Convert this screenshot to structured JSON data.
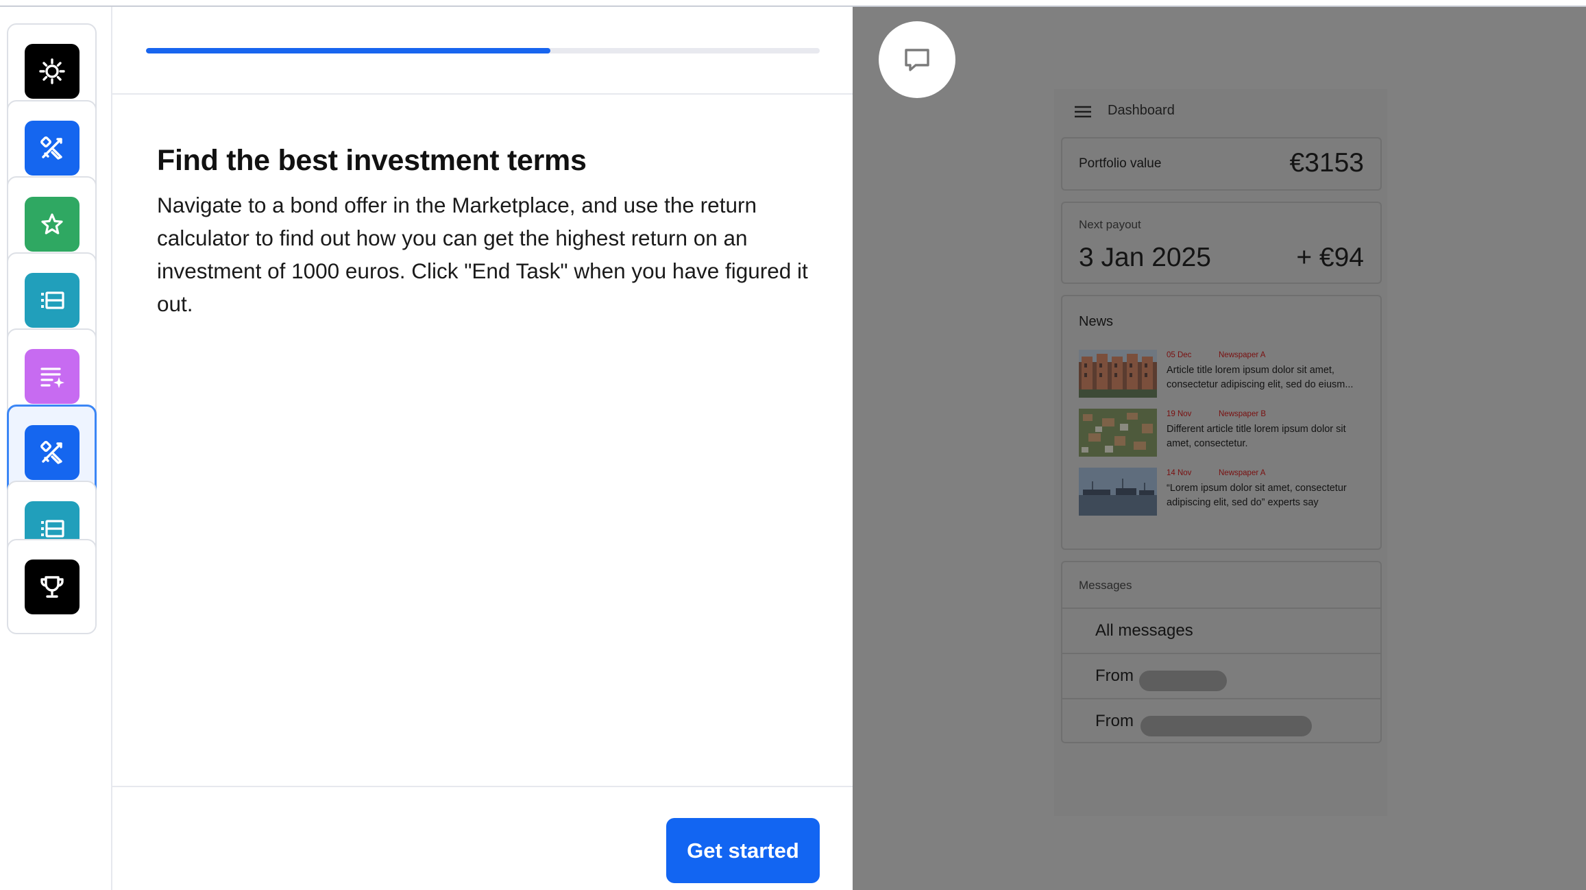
{
  "sidebar": {
    "items": [
      {
        "icon": "gear-icon",
        "tile_color": "#000000"
      },
      {
        "icon": "tools-icon",
        "tile_color": "#1566ef"
      },
      {
        "icon": "star-icon",
        "tile_color": "#2fa862"
      },
      {
        "icon": "list-icon",
        "tile_color": "#219fbb"
      },
      {
        "icon": "sparkle-list-icon",
        "tile_color": "#c76bf1"
      },
      {
        "icon": "tools-icon",
        "tile_color": "#1566ef",
        "active": true
      },
      {
        "icon": "list-icon",
        "tile_color": "#219fbb"
      },
      {
        "icon": "trophy-icon",
        "tile_color": "#000000"
      }
    ]
  },
  "task": {
    "progress_fraction": 0.6,
    "title": "Find the best investment terms",
    "body": "Navigate to a bond offer in the Marketplace, and use the return calculator to find out how you can get the highest return on an investment of 1000 euros. Click \"End Task\" when you have figured it out.",
    "button_label": "Get started"
  },
  "preview": {
    "header_title": "Dashboard",
    "portfolio_label": "Portfolio value",
    "portfolio_value": "€3153",
    "payout_label": "Next payout",
    "payout_date": "3 Jan 2025",
    "payout_amount": "+ €94",
    "news_title": "News",
    "news": [
      {
        "date": "05 Dec",
        "source": "Newspaper A",
        "text": "Article title lorem ipsum dolor sit amet, consectetur adipiscing elit, sed do eiusm..."
      },
      {
        "date": "19 Nov",
        "source": "Newspaper B",
        "text": "Different article title lorem ipsum dolor sit amet, consectetur."
      },
      {
        "date": "14 Nov",
        "source": "Newspaper A",
        "text": "“Lorem ipsum dolor sit amet, consectetur adipiscing elit, sed do” experts say"
      }
    ],
    "messages_title": "Messages",
    "messages": [
      {
        "text": "All messages"
      },
      {
        "text": "From"
      },
      {
        "text": "From"
      }
    ]
  },
  "colors": {
    "accent": "#1265f2",
    "overlay": "#808080"
  }
}
